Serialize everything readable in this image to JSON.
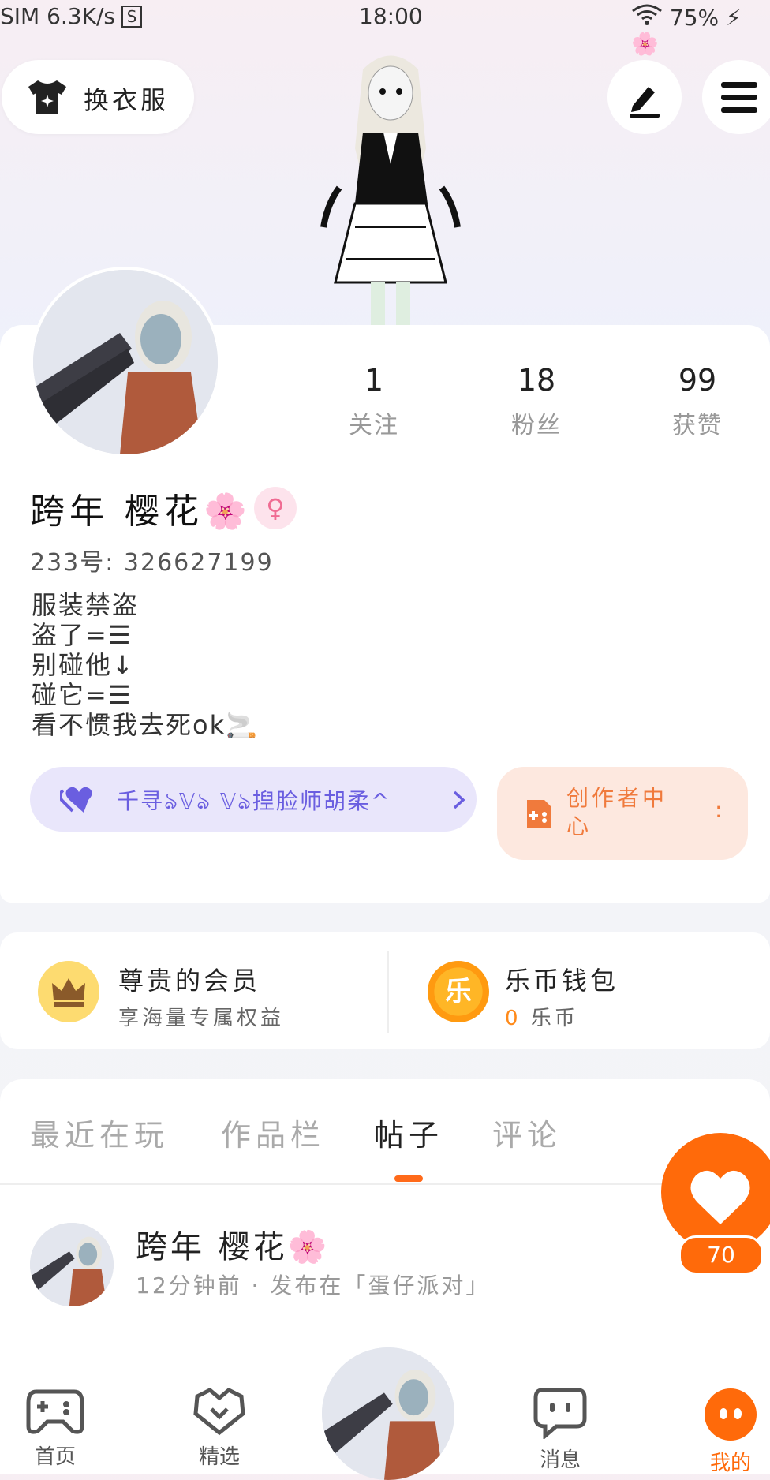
{
  "status_bar": {
    "left": "SIM 6.3K/s",
    "sim_icon": "S",
    "time": "18:00",
    "battery": "75%"
  },
  "top": {
    "outfit_label": "换衣服",
    "edit_icon": "pen-icon",
    "menu_icon": "menu-icon"
  },
  "profile": {
    "stats": [
      {
        "value": "1",
        "label": "关注"
      },
      {
        "value": "18",
        "label": "粉丝"
      },
      {
        "value": "99",
        "label": "获赞"
      }
    ],
    "name": "跨年 樱花🌸",
    "gender_symbol": "♀",
    "uid": "233号: 326627199",
    "bio": [
      "服装禁盗",
      "盗了=☰",
      "别碰他↓",
      "碰它=☰",
      "看不惯我去死ok🚬"
    ],
    "guild_text": "千寻ঌ𝕍ঌ 𝕍ঌ揑脸师胡柔^",
    "creator_text": "创作者中心",
    "creator_dot": ":"
  },
  "member": {
    "vip_title": "尊贵的会员",
    "vip_sub": "享海量专属权益",
    "wallet_title": "乐币钱包",
    "wallet_value": "0",
    "wallet_unit": "乐币",
    "wallet_coin": "乐"
  },
  "tabs": [
    "最近在玩",
    "作品栏",
    "帖子",
    "评论"
  ],
  "active_tab": 2,
  "post": {
    "author": "跨年 樱花🌸",
    "meta": "12分钟前 · 发布在「蛋仔派对」"
  },
  "fab": {
    "count": "70"
  },
  "nav": [
    "首页",
    "精选",
    "消息",
    "我的"
  ],
  "colors": {
    "accent": "#ff6a0a",
    "guild": "#6a5ee0",
    "creator": "#f07a3c"
  }
}
